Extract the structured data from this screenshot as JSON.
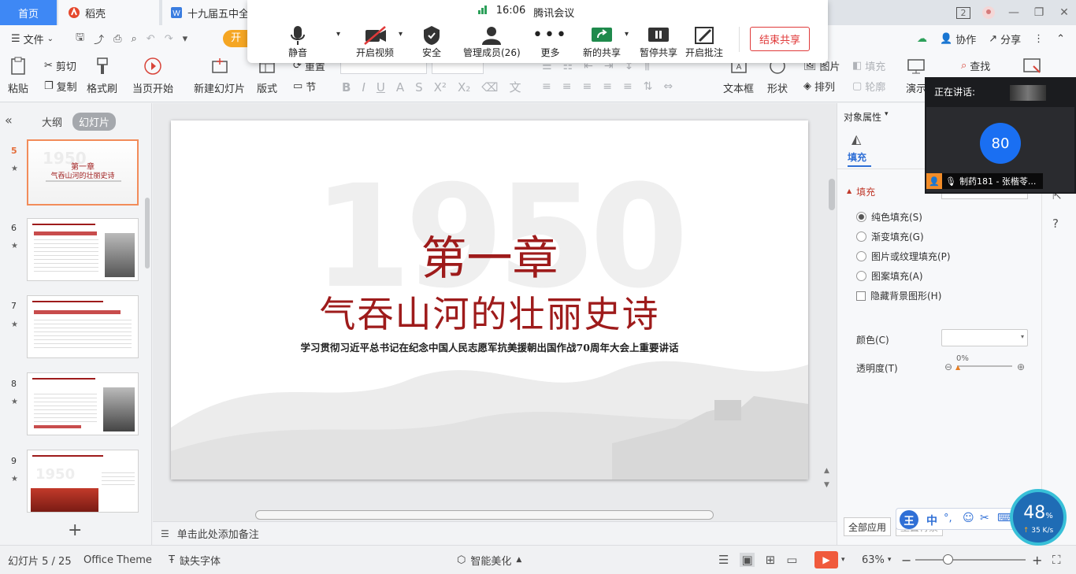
{
  "tabs": {
    "home": "首页",
    "daoke": "稻壳",
    "doc": "十九届五中全会",
    "num_badge": "2"
  },
  "menu": {
    "file": "文件",
    "start_tab": "开始",
    "collab": "协作",
    "share": "分享"
  },
  "ribbon": {
    "paste": "粘贴",
    "cut": "剪切",
    "copy": "复制",
    "format_painter": "格式刷",
    "from_current": "当页开始",
    "new_slide": "新建幻灯片",
    "layout": "版式",
    "reset": "重置",
    "section": "节",
    "textbox": "文本框",
    "shape": "形状",
    "arrange": "排列",
    "picture": "图片",
    "fill": "填充",
    "outline": "轮廓",
    "find": "查找",
    "present": "演示"
  },
  "meeting": {
    "time": "16:06",
    "app_title": "腾讯会议",
    "mute": "静音",
    "video": "开启视频",
    "security": "安全",
    "members": "管理成员(26)",
    "more": "更多",
    "new_share": "新的共享",
    "pause_share": "暂停共享",
    "annotate": "开启批注",
    "end_share": "结束共享"
  },
  "speaker": {
    "title": "正在讲话:",
    "avatar_num": "80",
    "name": "制药181 - 张楷苓..."
  },
  "left_panel": {
    "outline_tab": "大纲",
    "slides_tab": "幻灯片",
    "thumbs": [
      {
        "num": "5",
        "title": "第一章",
        "subtitle": "气吞山河的壮丽史诗"
      },
      {
        "num": "6"
      },
      {
        "num": "7"
      },
      {
        "num": "8"
      },
      {
        "num": "9"
      }
    ],
    "add": "+"
  },
  "slide": {
    "chapter": "第一章",
    "title": "气吞山河的壮丽史诗",
    "subtitle": "学习贯彻习近平总书记在纪念中国人民志愿军抗美援朝出国作战70周年大会上重要讲话",
    "bg_number": "1950",
    "accent": "#9e1b1b"
  },
  "notes": {
    "placeholder": "单击此处添加备注"
  },
  "right_panel": {
    "header": "对象属性",
    "fill_tab": "填充",
    "section": "填充",
    "options": [
      "纯色填充(S)",
      "渐变填充(G)",
      "图片或纹理填充(P)",
      "图案填充(A)"
    ],
    "selected_option": 0,
    "hide_bg": "隐藏背景图形(H)",
    "color_label": "颜色(C)",
    "transparency_label": "透明度(T)",
    "transparency_value": "0%",
    "apply_all": "全部应用",
    "reset_bg": "重置背景"
  },
  "ime": {
    "lang": "中"
  },
  "net": {
    "percent": "48",
    "percent_unit": "%",
    "speed": "35 K/s"
  },
  "status": {
    "slide_info": "幻灯片 5 / 25",
    "theme": "Office Theme",
    "missing_font": "缺失字体",
    "beautify": "智能美化",
    "zoom": "63%"
  }
}
